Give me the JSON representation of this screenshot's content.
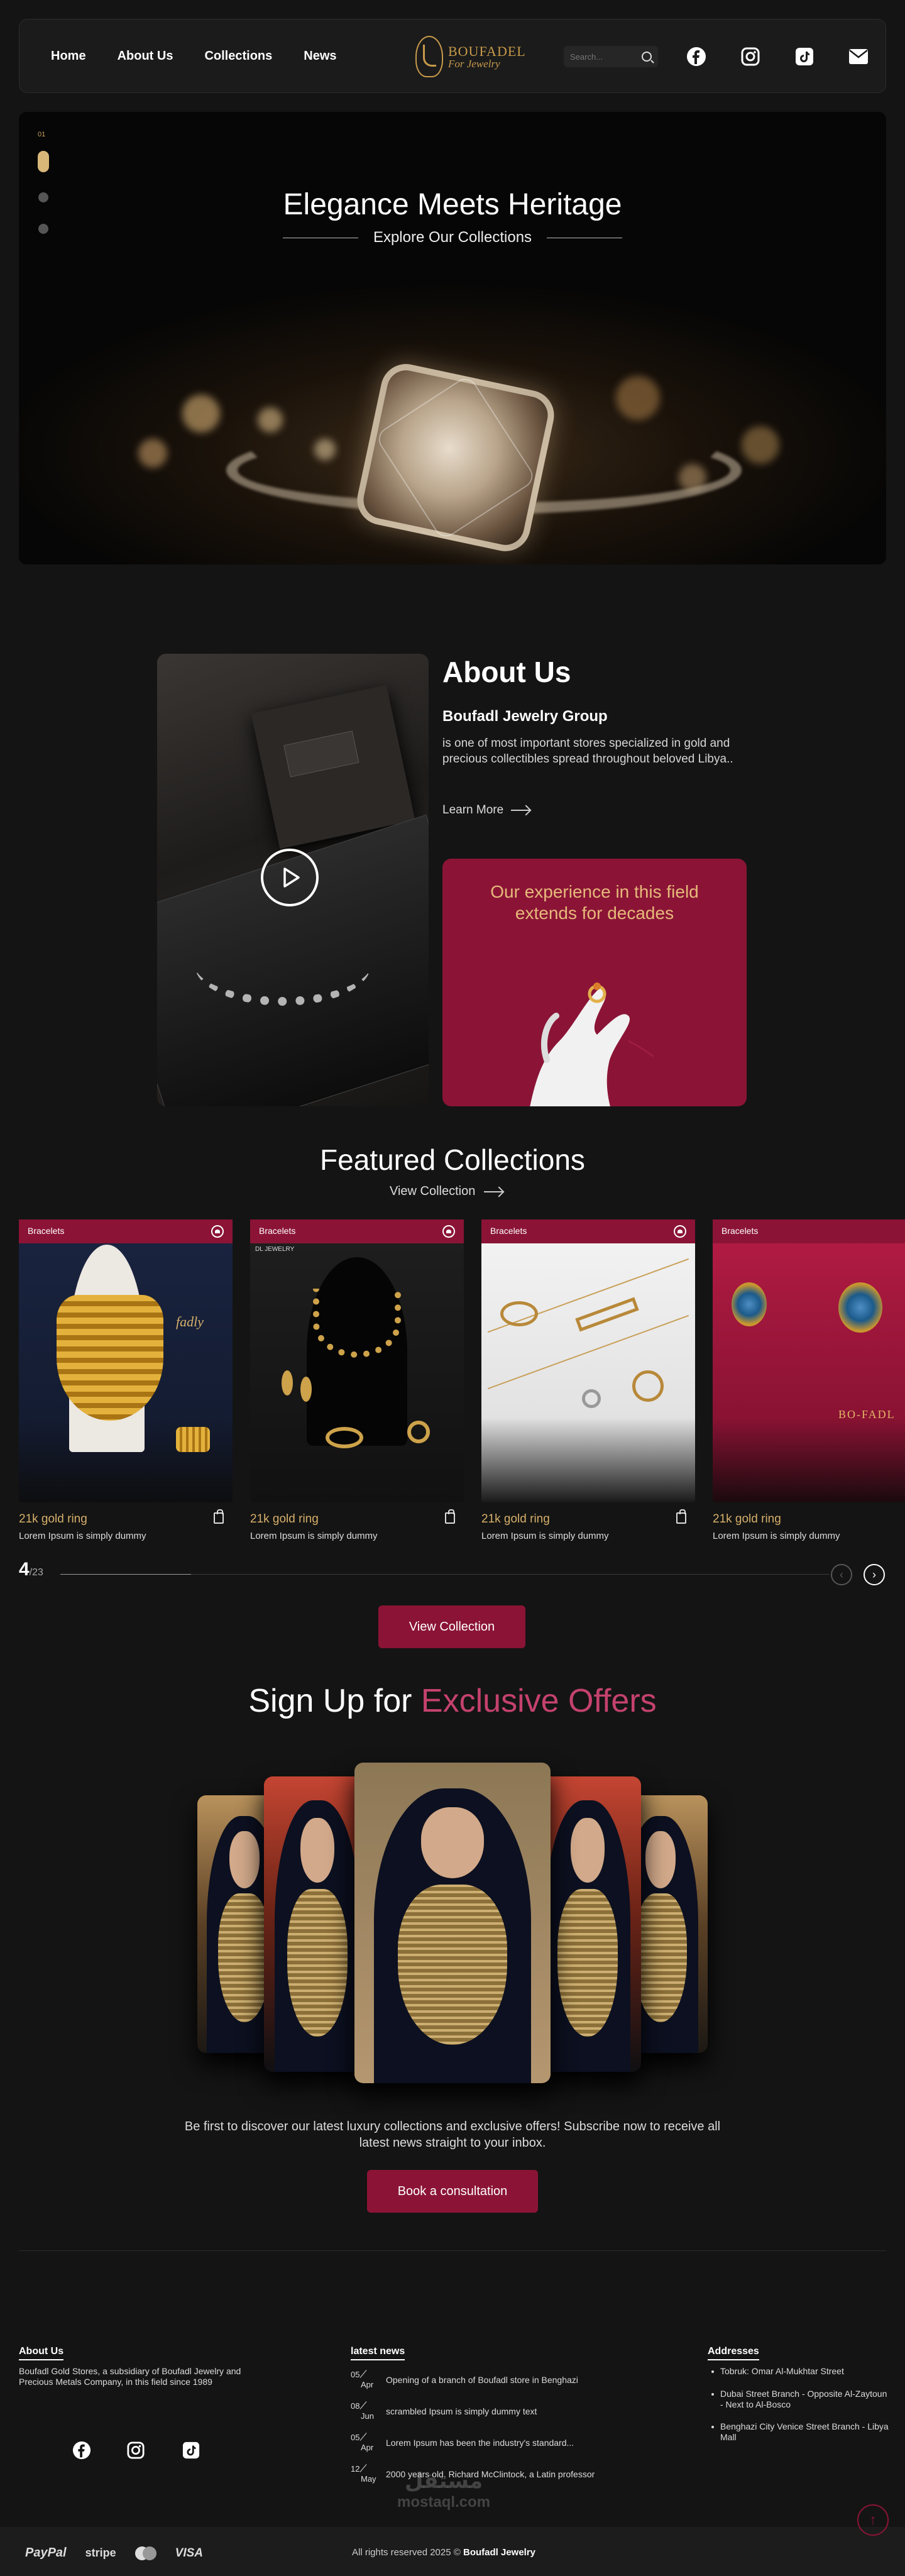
{
  "nav": {
    "links": [
      "Home",
      "About Us",
      "Collections",
      "News"
    ],
    "logo_line1": "BOUFADEL",
    "logo_line2": "For Jewelry",
    "search_placeholder": "Search...",
    "socials": [
      "facebook-icon",
      "instagram-icon",
      "tiktok-icon",
      "mail-icon"
    ]
  },
  "hero": {
    "index": "01",
    "title": "Elegance Meets Heritage",
    "subtitle": "Explore Our Collections"
  },
  "about": {
    "title": "About Us",
    "company": "Boufadl Jewelry Group",
    "description": "is one of most important stores specialized in gold and precious collectibles spread throughout beloved Libya..",
    "learn_more": "Learn More",
    "experience": "Our experience in this field extends for decades"
  },
  "featured": {
    "title": "Featured Collections",
    "view_link": "View Collection",
    "cards": [
      {
        "tag": "Bracelets",
        "name": "21k gold ring",
        "desc": "Lorem Ipsum is simply dummy"
      },
      {
        "tag": "Bracelets",
        "name": "21k gold ring",
        "desc": "Lorem Ipsum is simply dummy"
      },
      {
        "tag": "Bracelets",
        "name": "21k gold ring",
        "desc": "Lorem Ipsum is simply dummy"
      },
      {
        "tag": "Bracelets",
        "name": "21k gold ring",
        "desc": "Lorem Ipsum is simply dummy"
      }
    ],
    "card2_label": "DL JEWELRY",
    "card4_label": "BO-FADL",
    "pager_current": "4",
    "pager_total": "/23",
    "progress": 0.17,
    "button": "View Collection"
  },
  "signup": {
    "title_plain": "Sign Up for ",
    "title_highlight": "Exclusive Offers",
    "text": "Be first to discover our latest luxury collections and exclusive offers! Subscribe now to receive all latest news straight to your inbox.",
    "button": "Book a consultation"
  },
  "footer": {
    "about_heading": "About Us",
    "about_text": "Boufadl Gold Stores, a subsidiary of Boufadl Jewelry and Precious Metals Company, in this field since 1989",
    "news_heading": "latest news",
    "news": [
      {
        "day": "05",
        "month": "Apr",
        "text": "Opening of a branch of Boufadl store in Benghazi"
      },
      {
        "day": "08",
        "month": "Jun",
        "text": "scrambled Ipsum is simply dummy text"
      },
      {
        "day": "05",
        "month": "Apr",
        "text": "Lorem Ipsum has been the industry's standard..."
      },
      {
        "day": "12",
        "month": "May",
        "text": "2000 years old. Richard McClintock, a Latin professor"
      }
    ],
    "addresses_heading": "Addresses",
    "addresses": [
      "Tobruk: Omar Al-Mukhtar Street",
      "Dubai Street Branch - Opposite Al-Zaytoun - Next to Al-Bosco",
      "Benghazi City Venice Street Branch - Libya Mall"
    ],
    "payments": [
      "PayPal",
      "stripe",
      "mastercard",
      "VISA"
    ],
    "copyright": "All rights reserved 2025 ©",
    "brand": "Boufadl Jewelry",
    "watermark": "مستقل",
    "watermark_sub": "mostaql.com"
  },
  "colors": {
    "accent": "#8b1436",
    "gold": "#d6b06a",
    "highlight": "#c4426d",
    "background": "#141414"
  }
}
